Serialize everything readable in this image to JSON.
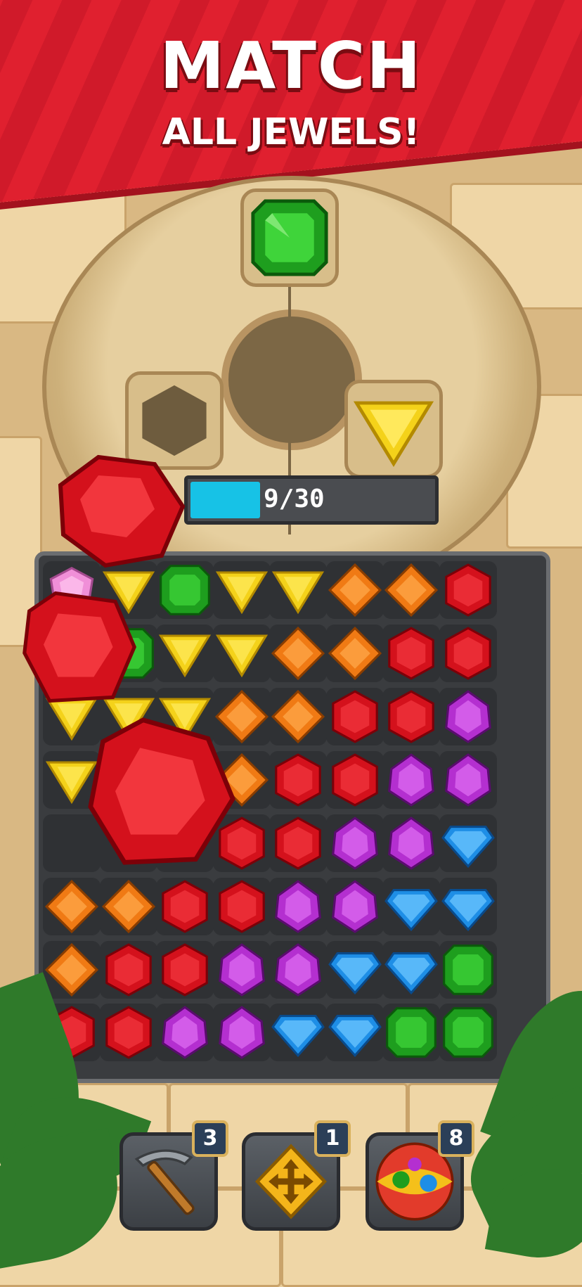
{
  "banner": {
    "line1": "MATCH",
    "line2": "ALL JEWELS!"
  },
  "progress": {
    "current": 9,
    "total": 30,
    "label": "9/30"
  },
  "colors": {
    "red": "#d4111c",
    "green": "#1e9e1e",
    "yellow": "#f4d21a",
    "orange": "#f07a14",
    "purple": "#b42fd0",
    "blue": "#1e8ee6",
    "pink": "#f08fd8",
    "empty": "none"
  },
  "board": [
    [
      "pink",
      "yellow",
      "green",
      "yellow",
      "yellow",
      "orange",
      "orange",
      "red"
    ],
    [
      "empty",
      "green",
      "yellow",
      "yellow",
      "orange",
      "orange",
      "red",
      "red"
    ],
    [
      "yellow",
      "yellow",
      "yellow",
      "orange",
      "orange",
      "red",
      "red",
      "purple"
    ],
    [
      "yellow",
      "red",
      "red",
      "orange",
      "red",
      "red",
      "purple",
      "purple"
    ],
    [
      "empty",
      "empty",
      "empty",
      "red",
      "red",
      "purple",
      "purple",
      "blue"
    ],
    [
      "orange",
      "orange",
      "red",
      "red",
      "purple",
      "purple",
      "blue",
      "blue"
    ],
    [
      "orange",
      "red",
      "red",
      "purple",
      "purple",
      "blue",
      "blue",
      "green"
    ],
    [
      "red",
      "red",
      "purple",
      "purple",
      "blue",
      "blue",
      "green",
      "green"
    ]
  ],
  "boosters": [
    {
      "name": "pickaxe",
      "count": "3"
    },
    {
      "name": "swap-arrows",
      "count": "1"
    },
    {
      "name": "color-orb",
      "count": "8"
    }
  ]
}
